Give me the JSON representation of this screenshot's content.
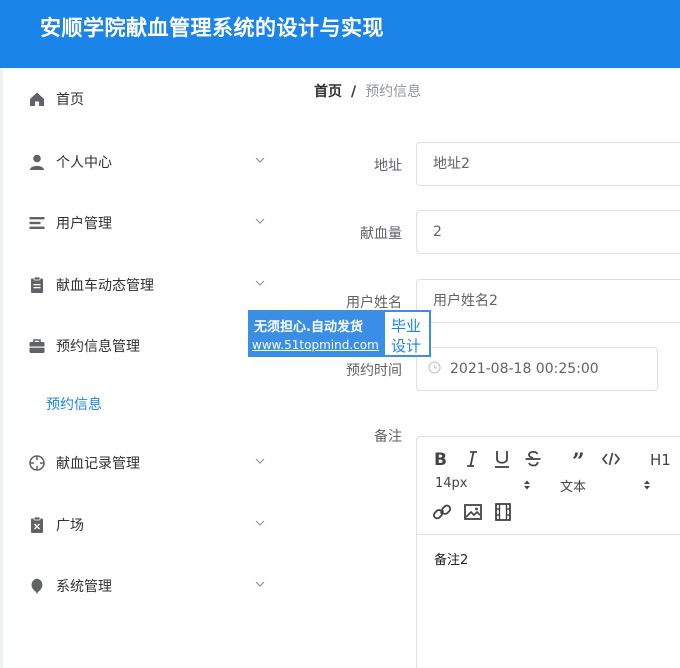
{
  "header": {
    "title": "安顺学院献血管理系统的设计与实现"
  },
  "sidebar": {
    "items": [
      {
        "label": "首页",
        "icon": "home-icon"
      },
      {
        "label": "个人中心",
        "icon": "user-icon"
      },
      {
        "label": "用户管理",
        "icon": "list-icon"
      },
      {
        "label": "献血车动态管理",
        "icon": "clipboard-icon"
      },
      {
        "label": "预约信息管理",
        "icon": "briefcase-icon"
      },
      {
        "label": "献血记录管理",
        "icon": "crosshair-icon"
      },
      {
        "label": "广场",
        "icon": "clipboard-x-icon"
      },
      {
        "label": "系统管理",
        "icon": "leaf-icon"
      }
    ],
    "sub_item": "预约信息",
    "active_color": "#1b84e8"
  },
  "breadcrumb": {
    "home": "首页",
    "separator": "/",
    "current": "预约信息"
  },
  "form": {
    "address_label": "地址",
    "address_value": "地址2",
    "amount_label": "献血量",
    "amount_value": "2",
    "name_label": "用户姓名",
    "name_value": "用户姓名2",
    "time_label": "预约时间",
    "time_value": "2021-08-18 00:25:00",
    "remark_label": "备注"
  },
  "editor": {
    "font_size": "14px",
    "text_style": "文本",
    "heading": "H1",
    "content": "备注2"
  },
  "watermark": {
    "line1": "无须担心.自动发货",
    "line2": "www.51topmind.com",
    "box1": "毕业",
    "box2": "设计"
  },
  "colors": {
    "header": "#1b84e8",
    "text": "#303133",
    "border": "#dcdfe6"
  }
}
